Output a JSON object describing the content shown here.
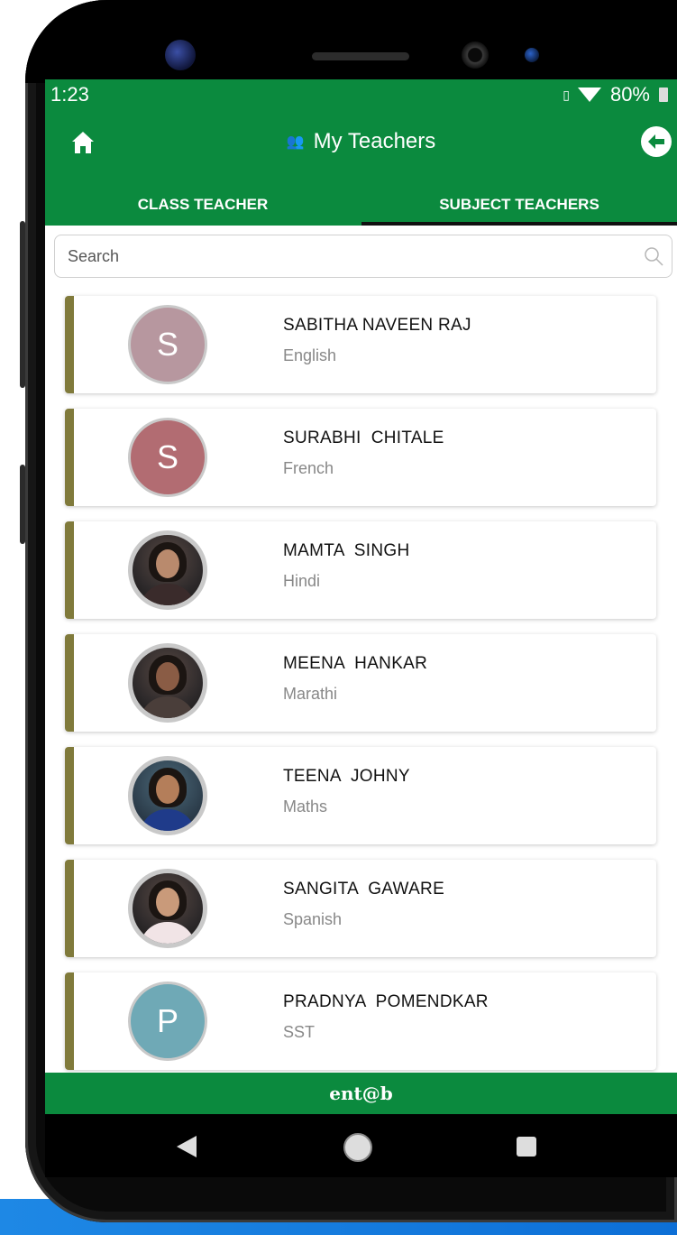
{
  "status_bar": {
    "time": "1:23",
    "battery": "80%"
  },
  "header": {
    "title": "My Teachers"
  },
  "tabs": [
    {
      "label": "CLASS TEACHER",
      "active": false
    },
    {
      "label": "SUBJECT TEACHERS",
      "active": true
    }
  ],
  "search": {
    "placeholder": "Search"
  },
  "teachers": [
    {
      "name": "SABITHA NAVEEN RAJ",
      "subject": "English",
      "initial": "S",
      "avatar_color": "#b7979f",
      "photo": false
    },
    {
      "name": "SURABHI  CHITALE",
      "subject": "French",
      "initial": "S",
      "avatar_color": "#b26c72",
      "photo": false
    },
    {
      "name": "MAMTA  SINGH",
      "subject": "Hindi",
      "initial": "",
      "photo": true
    },
    {
      "name": "MEENA  HANKAR",
      "subject": "Marathi",
      "initial": "",
      "photo": true
    },
    {
      "name": "TEENA  JOHNY",
      "subject": "Maths",
      "initial": "",
      "photo": true
    },
    {
      "name": "SANGITA  GAWARE",
      "subject": "Spanish",
      "initial": "",
      "photo": true
    },
    {
      "name": "PRADNYA  POMENDKAR",
      "subject": "SST",
      "initial": "P",
      "avatar_color": "#6fa9b6",
      "photo": false
    }
  ],
  "footer": {
    "brand": "ent@b"
  },
  "colors": {
    "primary": "#0b8a3e",
    "accent_bar": "#807a3b",
    "tab_indicator": "#101010"
  }
}
